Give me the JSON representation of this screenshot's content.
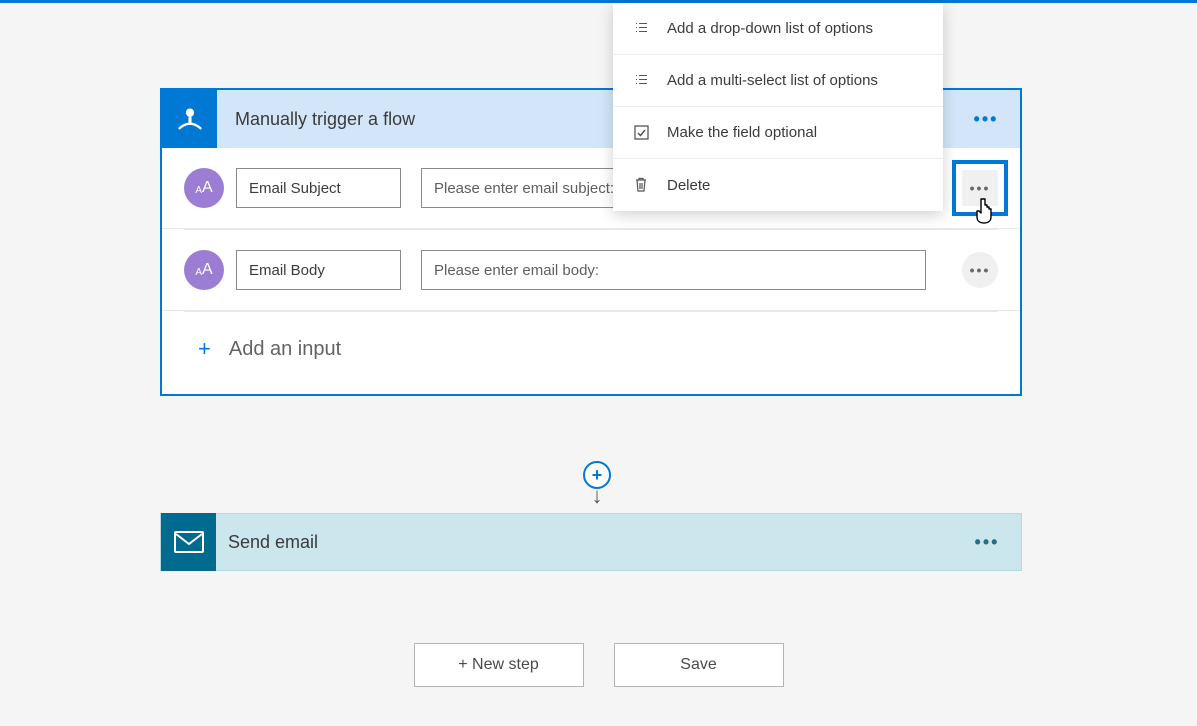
{
  "trigger": {
    "title": "Manually trigger a flow",
    "params": [
      {
        "name": "Email Subject",
        "placeholder": "Please enter email subject:"
      },
      {
        "name": "Email Body",
        "placeholder": "Please enter email body:"
      }
    ],
    "add_input_label": "Add an input"
  },
  "popup": {
    "items": [
      {
        "icon": "list-icon",
        "label": "Add a drop-down list of options"
      },
      {
        "icon": "multiselect-icon",
        "label": "Add a multi-select list of options"
      },
      {
        "icon": "checkbox-icon",
        "label": "Make the field optional"
      },
      {
        "icon": "trash-icon",
        "label": "Delete"
      }
    ]
  },
  "action": {
    "title": "Send email"
  },
  "footer": {
    "new_step": "+ New step",
    "save": "Save"
  },
  "glyph": {
    "text_icon": "AA"
  }
}
